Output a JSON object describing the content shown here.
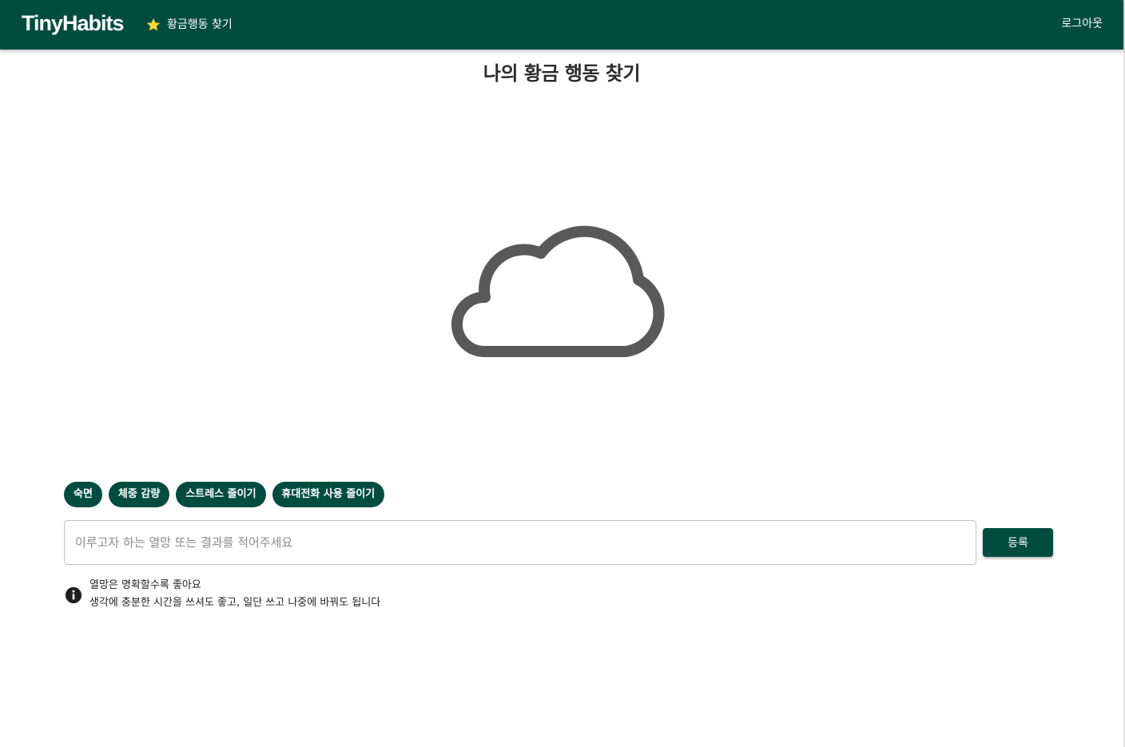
{
  "appbar": {
    "brand": "TinyHabits",
    "nav_link_label": "황금행동 찾기",
    "nav_icon": "star-icon",
    "logout_label": "로그아웃",
    "background_color": "#004d40",
    "star_color": "#fdd835"
  },
  "main": {
    "title": "나의 황금 행동 찾기",
    "illustration_icon": "cloud-outline-icon",
    "chips": [
      {
        "label": "숙면"
      },
      {
        "label": "체중 감량"
      },
      {
        "label": "스트레스 줄이기"
      },
      {
        "label": "휴대전화 사용 줄이기"
      }
    ],
    "input": {
      "value": "",
      "placeholder": "이루고자 하는 열망 또는 결과를 적어주세요"
    },
    "submit_label": "등록",
    "hint": {
      "icon": "info-icon",
      "line1": "열망은 명확할수록 좋아요",
      "line2": "생각에 충분한 시간을 쓰셔도 좋고, 일단 쓰고 나중에 바꿔도 됩니다"
    }
  }
}
